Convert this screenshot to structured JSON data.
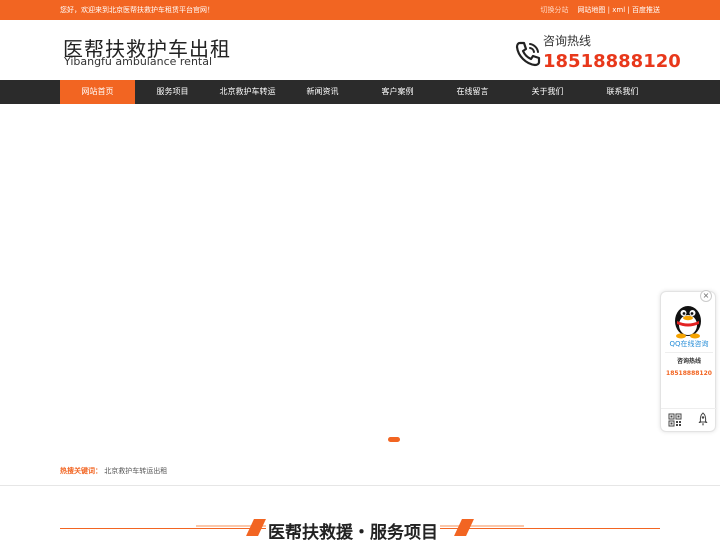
{
  "topbar": {
    "welcome": "您好，欢迎来到北京医帮扶救护车租赁平台官网！",
    "switch_site": "切换分站",
    "sitemap": "网站地图",
    "sep1": "|",
    "xml": "xml",
    "sep2": "|",
    "baidu": "百度推送"
  },
  "header": {
    "logo_cn": "医帮扶救护车出租",
    "logo_en": "Yibangfu ambulance rental",
    "hotline_label": "咨询热线",
    "hotline_number": "18518888120"
  },
  "nav": {
    "items": [
      {
        "label": "网站首页"
      },
      {
        "label": "服务项目"
      },
      {
        "label": "北京救护车转运"
      },
      {
        "label": "新闻资讯"
      },
      {
        "label": "客户案例"
      },
      {
        "label": "在线留言"
      },
      {
        "label": "关于我们"
      },
      {
        "label": "联系我们"
      }
    ]
  },
  "keywords": {
    "label": "热搜关键词：",
    "value": "北京救护车转运出租"
  },
  "section": {
    "title": "医帮扶救援・服务项目"
  },
  "float_panel": {
    "close": "×",
    "qq_label": "QQ在线咨询",
    "hot_label": "咨询热线",
    "hot_number": "18518888120"
  },
  "colors": {
    "accent": "#f26522",
    "nav_bg": "#2b2b2b",
    "hotline": "#e8381b"
  },
  "icons": [
    "phone-icon",
    "qq-penguin-icon",
    "qrcode-icon",
    "back-to-top-icon",
    "close-icon"
  ]
}
